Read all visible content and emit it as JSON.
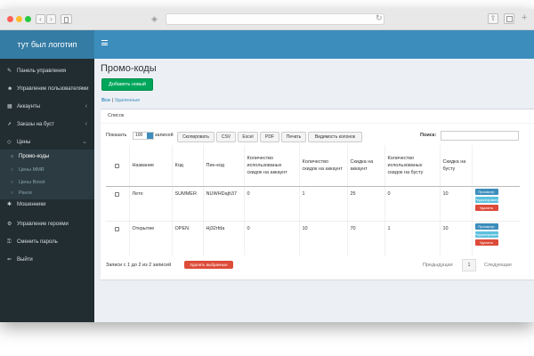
{
  "brand": {
    "logo_text": "тут был логотип"
  },
  "sidebar": {
    "items": [
      {
        "label": "Панель управления",
        "icon": "wrench-icon"
      },
      {
        "label": "Управление пользователями",
        "icon": "users-icon"
      },
      {
        "label": "Аккаунты",
        "icon": "accounts-icon"
      },
      {
        "label": "Заказы на буст",
        "icon": "rocket-icon"
      },
      {
        "label": "Цены",
        "icon": "diamond-icon"
      },
      {
        "label": "Мошенники",
        "icon": "alert-icon"
      },
      {
        "label": "Управление героями",
        "icon": "gear-icon"
      },
      {
        "label": "Сменить пароль",
        "icon": "lock-icon"
      },
      {
        "label": "Выйти",
        "icon": "exit-icon"
      }
    ],
    "subitems": [
      {
        "label": "Промо-коды"
      },
      {
        "label": "Цены MMR"
      },
      {
        "label": "Цены Boost"
      },
      {
        "label": "Ранги"
      }
    ]
  },
  "page": {
    "title": "Промо-коды",
    "add_button": "Добавить новый",
    "filter_all": "Все",
    "filter_separator": "|",
    "filter_deleted": "Удаленные"
  },
  "box": {
    "title": "Список",
    "show_label": "Показать",
    "page_size": "100",
    "show_label_suffix": "записей",
    "toolbar": [
      "Скопировать",
      "CSV",
      "Excel",
      "PDF",
      "Печать",
      "Видимость колонок"
    ],
    "search_label": "Поиск:"
  },
  "table": {
    "headers": [
      "Название",
      "Код",
      "Пин-код",
      "Количество использованых скидок на аккаунт",
      "Количество скидок на аккаунт",
      "Скидка на аккаунт",
      "Количество использованых скидок на бусту",
      "Скидка на бусту"
    ],
    "rows": [
      [
        "Лето",
        "SUMMER",
        "NUWHDajh37",
        "0",
        "1",
        "25",
        "0",
        "10"
      ],
      [
        "Открытие",
        "OPEN",
        "Hj32rfda",
        "0",
        "10",
        "70",
        "1",
        "10"
      ]
    ],
    "row_actions": {
      "view": "Просмотр",
      "edit": "Редактировать",
      "delete": "Удалить"
    }
  },
  "footer": {
    "info": "Записи с 1 до 2 из 2 записей",
    "delete_selected": "Удалить выбранные",
    "prev": "Предыдущая",
    "page": "1",
    "next": "Следующая"
  },
  "colors": {
    "header": "#3c8dbc",
    "sidebar": "#222d32",
    "add_button": "#00a65a",
    "delete": "#dd4b39"
  }
}
